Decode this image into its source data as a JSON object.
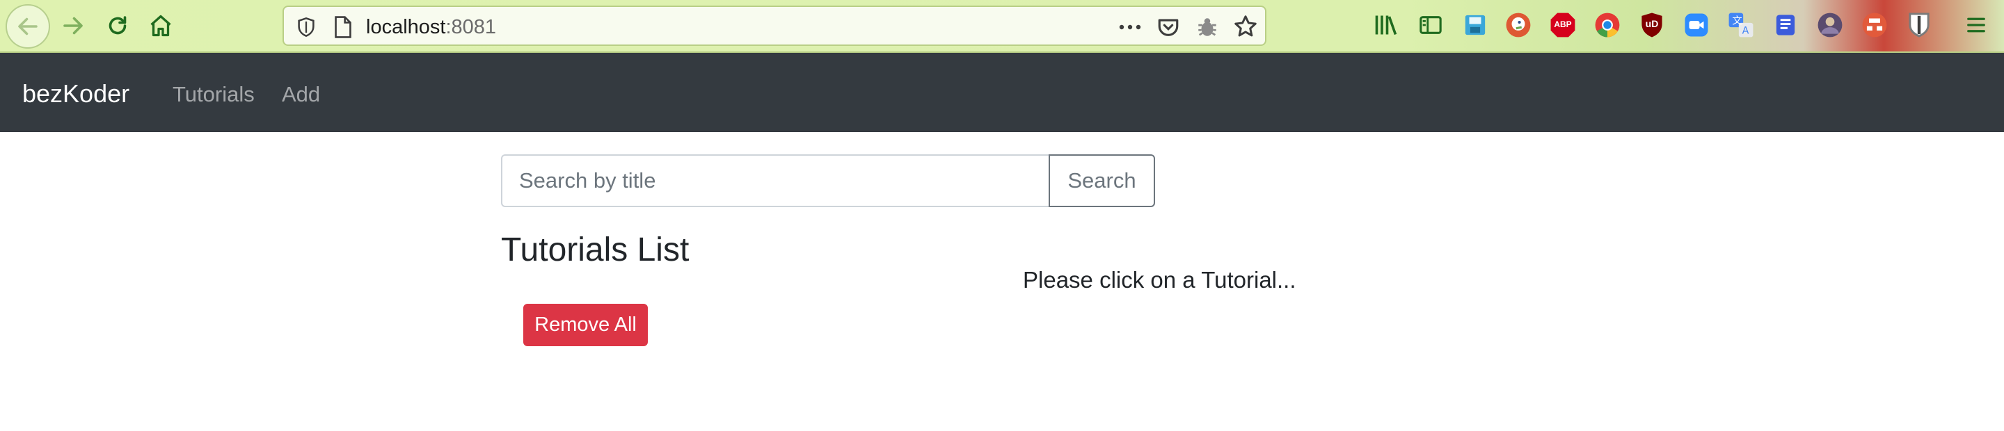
{
  "browser": {
    "url_host": "localhost",
    "url_port": ":8081",
    "icons": {
      "back": "back-arrow-icon",
      "forward": "forward-arrow-icon",
      "reload": "reload-icon",
      "home": "home-icon",
      "shield": "tracking-shield-icon",
      "page": "page-icon",
      "more": "more-actions-icon",
      "pocket": "pocket-icon",
      "bug": "bug-icon",
      "bookmark": "bookmark-star-icon"
    },
    "extensions": [
      "library-icon",
      "sidebar-icon",
      "save-icon",
      "duckduckgo-icon",
      "adblock-icon",
      "chrome-icon",
      "ublock-icon",
      "zoom-icon",
      "translate-icon",
      "extension-icon",
      "avatar-icon",
      "extension-icon-2",
      "bitwarden-icon",
      "menu-icon"
    ],
    "extension_labels": {
      "adblock": "ABP",
      "ublock": "uD"
    },
    "theme_color": "#dff2b0"
  },
  "navbar": {
    "brand": "bezKoder",
    "links": [
      "Tutorials",
      "Add"
    ],
    "background": "#343a40"
  },
  "search": {
    "placeholder": "Search by title",
    "value": "",
    "button_label": "Search"
  },
  "tutorials": {
    "title": "Tutorials List",
    "items": [],
    "remove_all_label": "Remove All",
    "remove_all_color": "#dc3545"
  },
  "details": {
    "hint": "Please click on a Tutorial..."
  }
}
